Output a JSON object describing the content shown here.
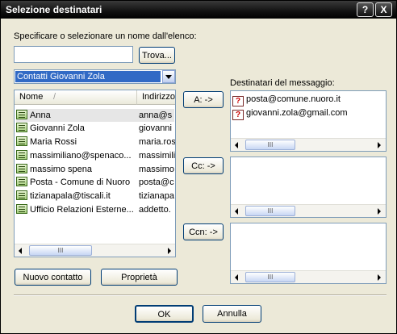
{
  "window": {
    "title": "Selezione destinatari",
    "help_button": "?",
    "close_button": "X"
  },
  "search": {
    "label": "Specificare o selezionare un nome dall'elenco:",
    "value": "",
    "find_button": "Trova..."
  },
  "address_book": {
    "selected": "Contatti Giovanni Zola"
  },
  "contacts": {
    "columns": [
      "Nome",
      "/",
      "Indirizzo"
    ],
    "rows": [
      {
        "name": "Anna",
        "address": "anna@s"
      },
      {
        "name": "Giovanni Zola",
        "address": "giovanni"
      },
      {
        "name": "Maria Rossi",
        "address": "maria.ros"
      },
      {
        "name": "massimiliano@spenaco...",
        "address": "massimili"
      },
      {
        "name": "massimo spena",
        "address": "massimo"
      },
      {
        "name": "Posta - Comune di Nuoro",
        "address": "posta@c"
      },
      {
        "name": "tizianapala@tiscali.it",
        "address": "tizianapa"
      },
      {
        "name": "Ufficio Relazioni Esterne...",
        "address": "addetto."
      }
    ]
  },
  "buttons": {
    "to": "A: ->",
    "cc": "Cc: ->",
    "bcc": "Ccn: ->",
    "new_contact": "Nuovo contatto",
    "properties": "Proprietà",
    "ok": "OK",
    "cancel": "Annulla"
  },
  "recipients": {
    "label": "Destinatari del messaggio:",
    "to": [
      "posta@comune.nuoro.it",
      "giovanni.zola@gmail.com"
    ],
    "cc": [],
    "bcc": []
  },
  "scroll": {
    "grip": "III"
  },
  "colors": {
    "dialog_bg": "#ece9d8",
    "selection": "#316ac5",
    "titlebar": "#111111"
  },
  "icons": [
    "contact-card-icon",
    "unresolved-address-icon",
    "dropdown-arrow-icon"
  ]
}
